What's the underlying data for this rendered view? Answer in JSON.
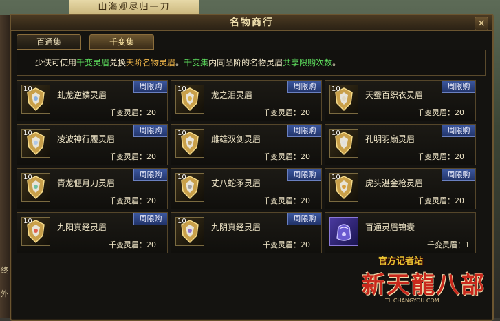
{
  "background": {
    "banner_text": "山海观尽归一刀",
    "left_fragments": [
      "终",
      "外"
    ]
  },
  "window": {
    "title": "名物商行",
    "close_label": "×"
  },
  "tabs": [
    {
      "label": "百通集",
      "active": false
    },
    {
      "label": "千变集",
      "active": true
    }
  ],
  "notice": {
    "parts": [
      {
        "text": "少侠可使用",
        "style": "white"
      },
      {
        "text": "千变灵眉",
        "style": "green"
      },
      {
        "text": "兑换",
        "style": "white"
      },
      {
        "text": "天阶名物灵眉",
        "style": "orange"
      },
      {
        "text": "。",
        "style": "white"
      },
      {
        "text": "千变集",
        "style": "green"
      },
      {
        "text": "内同品阶的名物灵眉",
        "style": "white"
      },
      {
        "text": "共享限购次数",
        "style": "green"
      },
      {
        "text": "。",
        "style": "white"
      }
    ]
  },
  "items": [
    {
      "name": "虬龙逆鳞灵眉",
      "price": "千变灵眉：20",
      "count": "10",
      "badge": "周限购",
      "icon": "shield-gem-icon"
    },
    {
      "name": "龙之泪灵眉",
      "price": "千变灵眉：20",
      "count": "10",
      "badge": "周限购",
      "icon": "shield-gem-icon"
    },
    {
      "name": "天蚕百织衣灵眉",
      "price": "千变灵眉：20",
      "count": "10",
      "badge": "周限购",
      "icon": "shield-gem-icon"
    },
    {
      "name": "凌波神行履灵眉",
      "price": "千变灵眉：20",
      "count": "10",
      "badge": "周限购",
      "icon": "shield-gem-icon"
    },
    {
      "name": "雌雄双剑灵眉",
      "price": "千变灵眉：20",
      "count": "10",
      "badge": "周限购",
      "icon": "shield-gem-icon"
    },
    {
      "name": "孔明羽扇灵眉",
      "price": "千变灵眉：20",
      "count": "10",
      "badge": "周限购",
      "icon": "shield-gem-icon"
    },
    {
      "name": "青龙偃月刀灵眉",
      "price": "千变灵眉：20",
      "count": "10",
      "badge": "周限购",
      "icon": "shield-gem-icon"
    },
    {
      "name": "丈八蛇矛灵眉",
      "price": "千变灵眉：20",
      "count": "10",
      "badge": "周限购",
      "icon": "shield-gem-icon"
    },
    {
      "name": "虎头湛金枪灵眉",
      "price": "千变灵眉：20",
      "count": "10",
      "badge": "周限购",
      "icon": "shield-gem-icon"
    },
    {
      "name": "九阳真经灵眉",
      "price": "千变灵眉：20",
      "count": "10",
      "badge": "周限购",
      "icon": "shield-gem-icon"
    },
    {
      "name": "九阴真经灵眉",
      "price": "千变灵眉：20",
      "count": "10",
      "badge": "周限购",
      "icon": "shield-gem-icon"
    },
    {
      "name": "百通灵眉锦囊",
      "price": "千变灵眉：1",
      "count": "",
      "badge": "",
      "icon": "purple-pouch-icon"
    }
  ],
  "watermark": {
    "top": "官方记者站",
    "logo": "新天龍八部",
    "url": "TL.CHANGYOU.COM"
  },
  "colors": {
    "accent_green": "#5ee05e",
    "accent_orange": "#f2b84a",
    "badge_blue": "#3c58a0",
    "frame_gold": "#6b5530"
  }
}
